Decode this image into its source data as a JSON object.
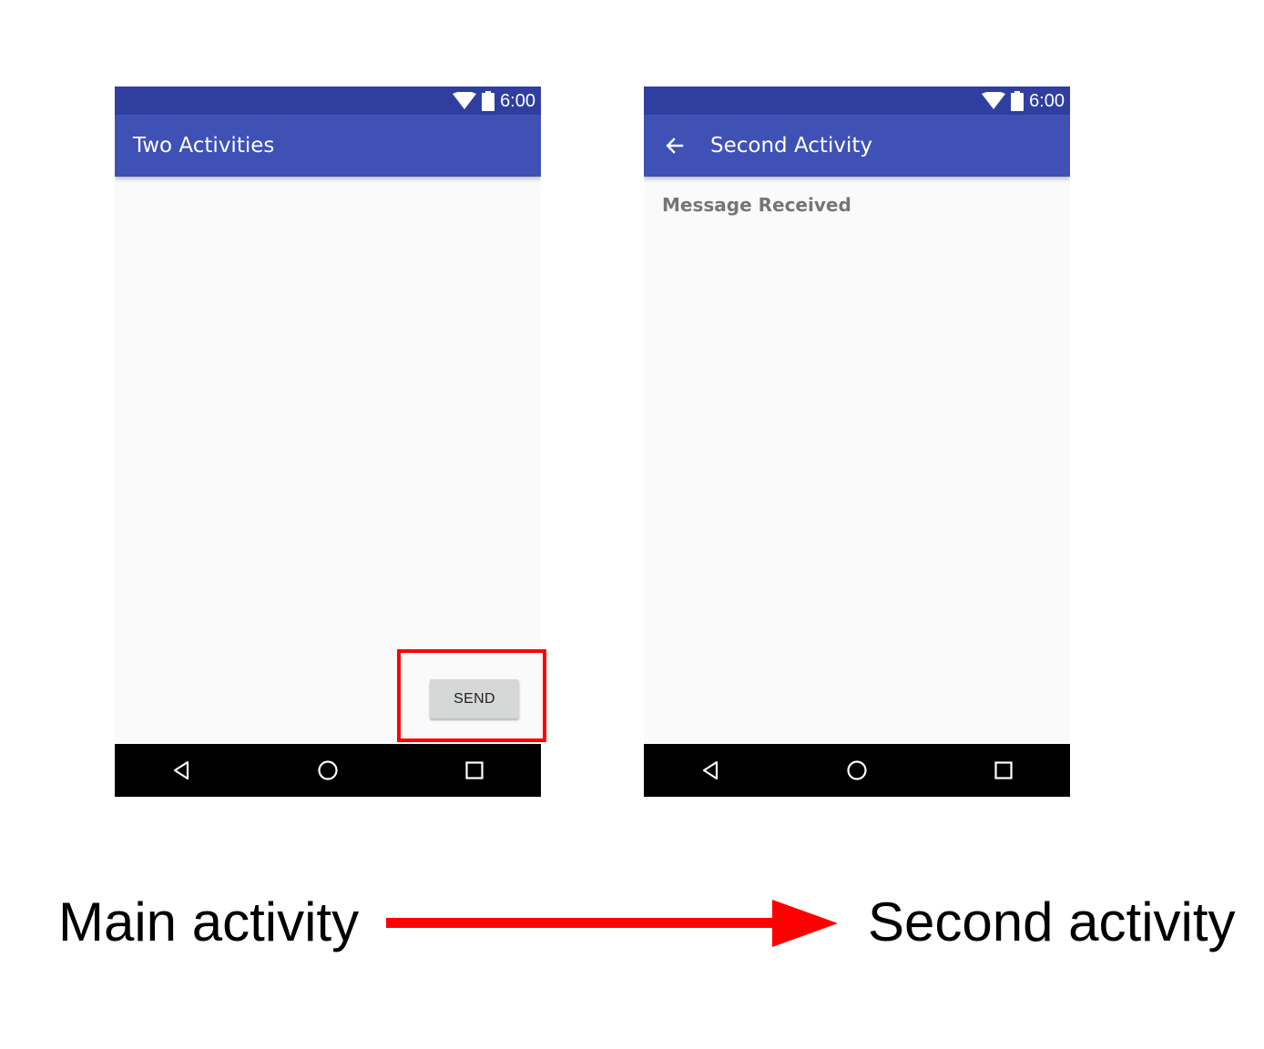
{
  "status_bar": {
    "time": "6:00",
    "color": "#303f9f"
  },
  "main_activity": {
    "title": "Two Activities",
    "send_button_label": "SEND",
    "app_bar_color": "#3f51b5"
  },
  "second_activity": {
    "title": "Second Activity",
    "message": "Message Received",
    "back_icon": "arrow-back-icon"
  },
  "nav_bar": {
    "icons": [
      "back-triangle-icon",
      "home-circle-icon",
      "recents-square-icon"
    ]
  },
  "captions": {
    "main": "Main activity",
    "second": "Second activity"
  },
  "highlight_color": "#ff0000"
}
